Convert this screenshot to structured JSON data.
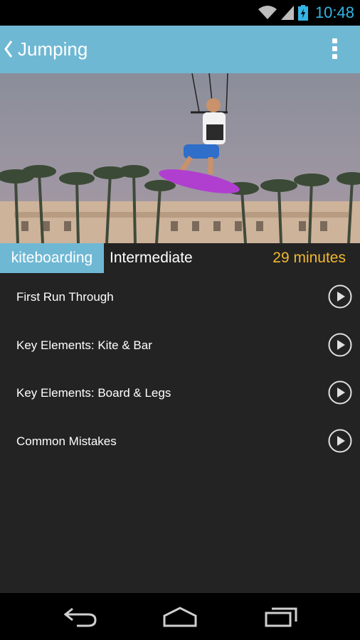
{
  "status_bar": {
    "time": "10:48"
  },
  "action_bar": {
    "title": "Jumping"
  },
  "info": {
    "sport": "kiteboarding",
    "level": "Intermediate",
    "duration": "29 minutes"
  },
  "lessons": [
    {
      "label": "First Run Through"
    },
    {
      "label": "Key Elements: Kite & Bar"
    },
    {
      "label": "Key Elements: Board & Legs"
    },
    {
      "label": "Common Mistakes"
    }
  ],
  "colors": {
    "accent": "#6fb8d4",
    "duration": "#f2b830",
    "background": "#232323"
  },
  "icons": {
    "back": "chevron-left-icon",
    "overflow": "overflow-menu-icon",
    "play": "play-circle-icon",
    "nav_back": "nav-back-icon",
    "nav_home": "nav-home-icon",
    "nav_recents": "nav-recents-icon"
  }
}
